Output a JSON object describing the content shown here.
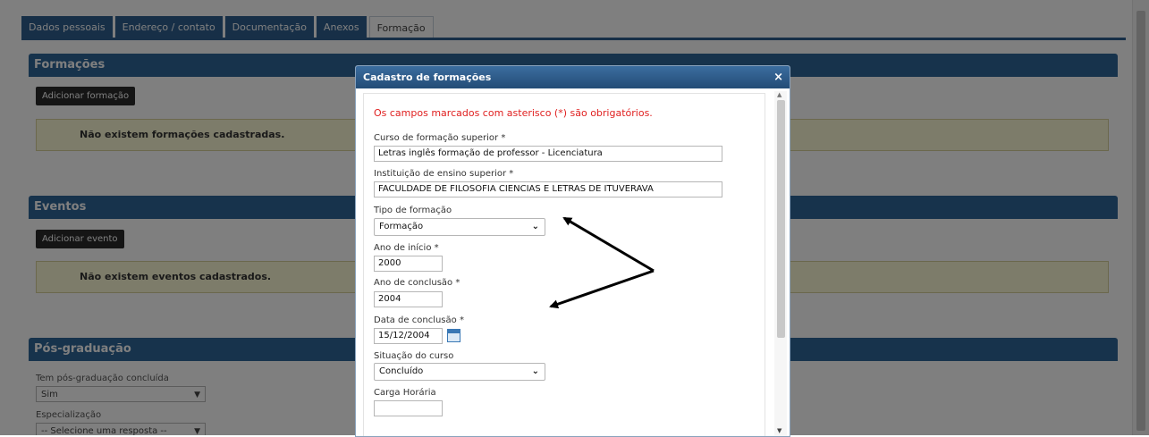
{
  "tabs": [
    "Dados pessoais",
    "Endereço / contato",
    "Documentação",
    "Anexos",
    "Formação"
  ],
  "sections": {
    "formacoes": {
      "title": "Formações",
      "button": "Adicionar formação",
      "empty": "Não existem formações cadastradas."
    },
    "eventos": {
      "title": "Eventos",
      "button": "Adicionar evento",
      "empty": "Não existem eventos cadastrados."
    },
    "posgraduacao": {
      "title": "Pós-graduação",
      "q1_label": "Tem pós-graduação concluída",
      "q1_value": "Sim",
      "q2_label": "Especialização",
      "q2_value": "-- Selecione uma resposta --"
    }
  },
  "modal": {
    "title": "Cadastro de formações",
    "close": "×",
    "required_note": "Os campos marcados com asterisco (*) são obrigatórios.",
    "fields": {
      "curso_label": "Curso de formação superior *",
      "curso_value": "Letras inglês formação de professor - Licenciatura",
      "instituicao_label": "Instituição de ensino superior *",
      "instituicao_value": "FACULDADE DE FILOSOFIA CIENCIAS E LETRAS DE ITUVERAVA",
      "tipo_label": "Tipo de formação",
      "tipo_value": "Formação",
      "ano_inicio_label": "Ano de início *",
      "ano_inicio_value": "2000",
      "ano_conclusao_label": "Ano de conclusão *",
      "ano_conclusao_value": "2004",
      "data_conclusao_label": "Data de conclusão *",
      "data_conclusao_value": "15/12/2004",
      "situacao_label": "Situação do curso",
      "situacao_value": "Concluído",
      "carga_label": "Carga Horária",
      "carga_value": ""
    }
  },
  "icons": {
    "chevron": "chevron-down-icon",
    "calendar": "calendar-icon",
    "close": "close-icon"
  },
  "colors": {
    "primary": "#2e6699",
    "required": "#e02020",
    "alert_bg": "#fbf8d4"
  }
}
